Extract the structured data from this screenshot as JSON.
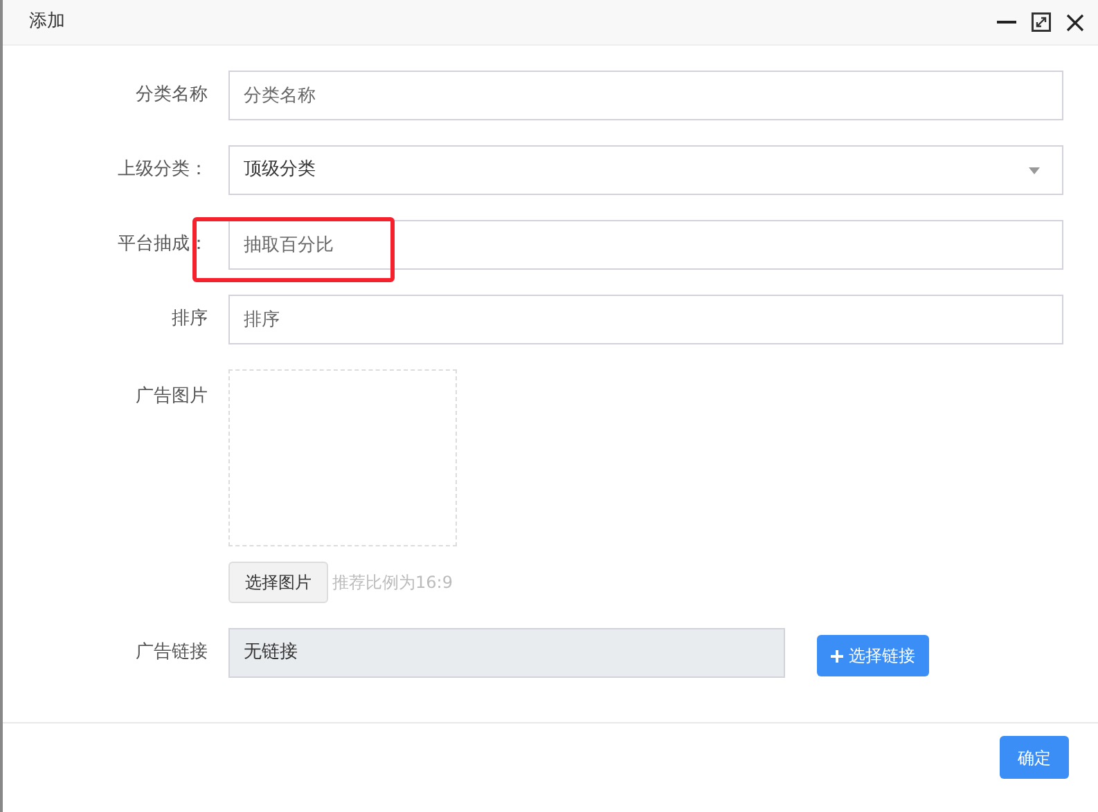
{
  "window": {
    "title": "添加"
  },
  "fields": [
    {
      "kind": "text",
      "label": "分类名称",
      "placeholder": "分类名称",
      "highlighted": false
    },
    {
      "kind": "select",
      "label": "上级分类：",
      "value": "顶级分类",
      "highlighted": false
    },
    {
      "kind": "text",
      "label": "平台抽成：",
      "placeholder": "抽取百分比",
      "highlighted": true
    },
    {
      "kind": "text",
      "label": "排序",
      "placeholder": "排序",
      "highlighted": false
    },
    {
      "kind": "image",
      "label": "广告图片",
      "button": "选择图片",
      "hint": "推荐比例为16:9"
    },
    {
      "kind": "link",
      "label": "广告链接",
      "value": "无链接",
      "button": "选择链接",
      "disabled": true
    }
  ],
  "footer": {
    "confirm": "确定"
  }
}
